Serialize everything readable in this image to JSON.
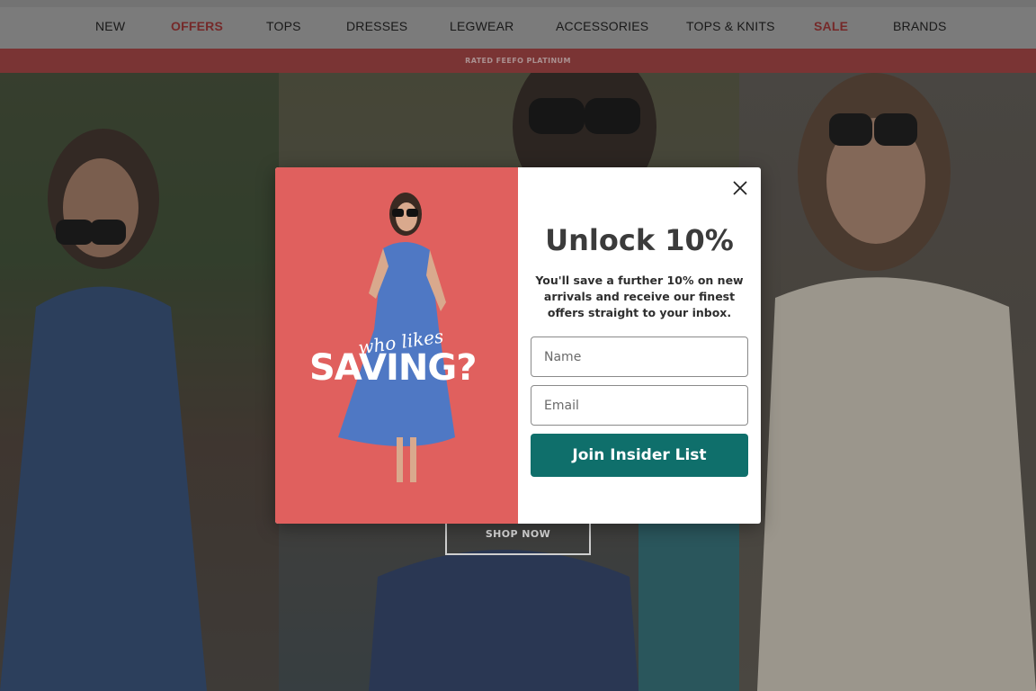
{
  "nav": {
    "items": [
      {
        "label": "NEW",
        "accent": false
      },
      {
        "label": "OFFERS",
        "accent": true
      },
      {
        "label": "TOPS",
        "accent": false
      },
      {
        "label": "DRESSES",
        "accent": false
      },
      {
        "label": "LEGWEAR",
        "accent": false
      },
      {
        "label": "ACCESSORIES",
        "accent": false
      },
      {
        "label": "TOPS & KNITS",
        "accent": false
      },
      {
        "label": "SALE",
        "accent": true
      },
      {
        "label": "BRANDS",
        "accent": false
      }
    ]
  },
  "announcement": {
    "text": "RATED FEEFO PLATINUM"
  },
  "hero": {
    "cta_label": "SHOP NOW"
  },
  "popup": {
    "image_caption_small": "who likes",
    "image_caption_big": "SAVING?",
    "title": "Unlock 10%",
    "description": "You'll save a further 10% on new arrivals and receive our finest offers straight to your inbox.",
    "name_placeholder": "Name",
    "email_placeholder": "Email",
    "submit_label": "Join Insider List"
  },
  "colors": {
    "accent_red": "#9e2a2a",
    "announcement_bg": "#a63b3b",
    "popup_image_bg": "#e0605e",
    "submit_bg": "#0f6f6b"
  }
}
